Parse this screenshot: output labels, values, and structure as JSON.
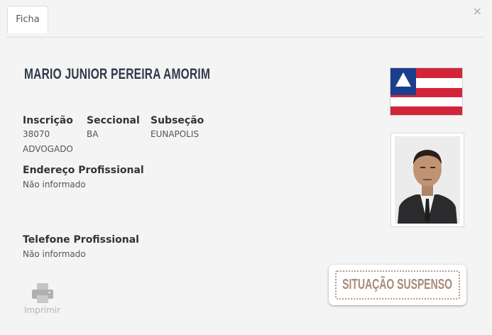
{
  "tabs": [
    {
      "label": "Ficha"
    }
  ],
  "close_label": "×",
  "person": {
    "name": "MARIO JUNIOR PEREIRA AMORIM",
    "inscricao_label": "Inscrição",
    "inscricao": "38070",
    "seccional_label": "Seccional",
    "seccional": "BA",
    "subsecao_label": "Subseção",
    "subsecao": "EUNAPOLIS",
    "tipo": "ADVOGADO",
    "endereco_label": "Endereço Profissional",
    "endereco": "Não informado",
    "telefone_label": "Telefone Profissional",
    "telefone": "Não informado"
  },
  "status": {
    "text": "SITUAÇÃO SUSPENSO",
    "color": "#a88b78"
  },
  "actions": {
    "print_label": "Imprimir",
    "print_icon": "printer-icon"
  },
  "flag": {
    "name": "bahia-flag",
    "colors": {
      "blue": "#1a3f8c",
      "red": "#d3253a",
      "white": "#ffffff"
    }
  }
}
